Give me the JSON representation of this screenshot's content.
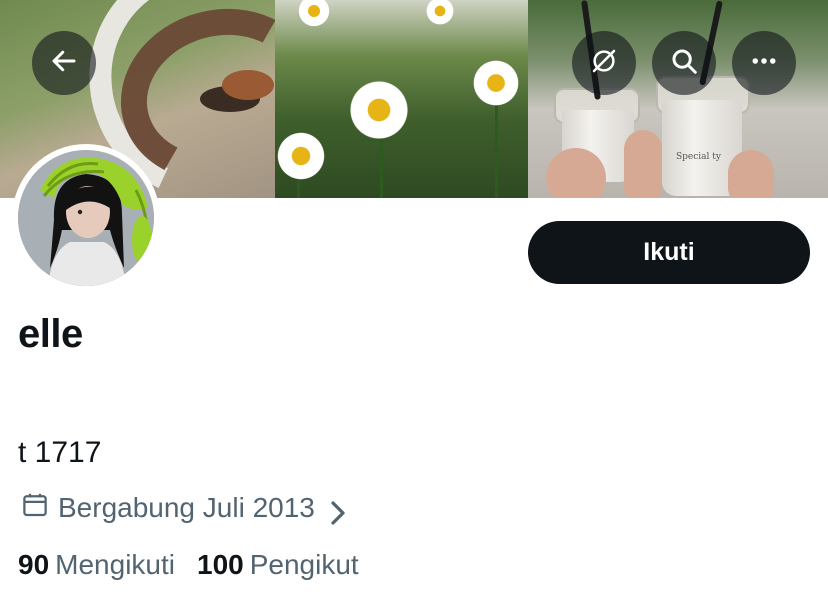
{
  "header": {
    "back_icon": "arrow-left-icon",
    "grok_icon": "slashed-circle-icon",
    "search_icon": "search-icon",
    "more_icon": "more-horizontal-icon"
  },
  "profile": {
    "display_name": "elle",
    "bio": "t 1717",
    "joined": "Bergabung Juli 2013",
    "follow_label": "Ikuti"
  },
  "stats": {
    "following_count": "90",
    "following_label": "Mengikuti",
    "followers_count": "100",
    "followers_label": "Pengikut"
  },
  "banner_cup_text": "Special ty",
  "colors": {
    "primary_text": "#0f1419",
    "secondary_text": "#536471",
    "button_bg": "#0f1419",
    "overlay_btn": "rgba(15,20,25,0.6)"
  }
}
